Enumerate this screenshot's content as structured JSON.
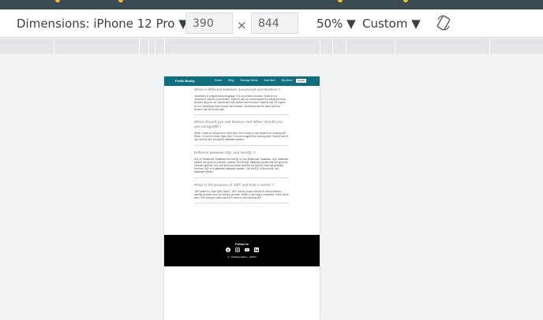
{
  "toolbar": {
    "dimensions_label": "Dimensions: iPhone 12 Pro ▼",
    "width": "390",
    "times": "×",
    "height": "844",
    "zoom": "50% ▼",
    "throttle": "Custom ▼"
  },
  "page": {
    "brand": "Fruits Buddy",
    "nav": [
      "Home",
      "Blog",
      "Manage Items",
      "Add Item",
      "My Items"
    ],
    "logout": "Logout",
    "qa": [
      {
        "q": "What is different between JavaScript and NodeJs ?",
        "a": "JavaScript is programming language. It is runs inside browser. NodeJs is a JavaScript runtime environment. NodeJS use for communicate the backend server. NodeJs helps to run JavaScript code without web browser. NodeJs use V8 engine for run JavaScript code outside the browser. JavaScript use for client side but NodeJs use for server side."
      },
      {
        "q": "When should you use NodeJs and When should you use mongoDB ?",
        "a": "When I need to call api from client side, then I have to use NodeJs for creating API. When I to need to store data, then I to use mongoDB for storing data. NodeJs use to api connect with mongoDB database system."
      },
      {
        "q": "Different between SQL and NoSQL ?",
        "a": "SQL is 'Relational' Database but NoSQL is 'non-Relational' Database. SQL database system are good for complex queries. But NoSQL database system are not good for complex queries. SQL are fixed and static schema but NoSQL have dynamically schema. SQL is a database database system , but NoSQL is document, key database system."
      },
      {
        "q": "What is the purpose of JWT and how it works ?",
        "a": "JWT stand for 'Json Web Token'. JWT use for proper identify of users between identity provider and one service provider. When a user login completed, at the same time, JWT will give token send it to token to the backend API."
      }
    ],
    "footer": {
      "title": "Follow Us",
      "copyright": "© - Towfiqul Islaam - 2022©"
    }
  },
  "colors": {
    "nav": "#0f6f80",
    "footer": "#000000",
    "toolbar_text": "#3c4043"
  }
}
